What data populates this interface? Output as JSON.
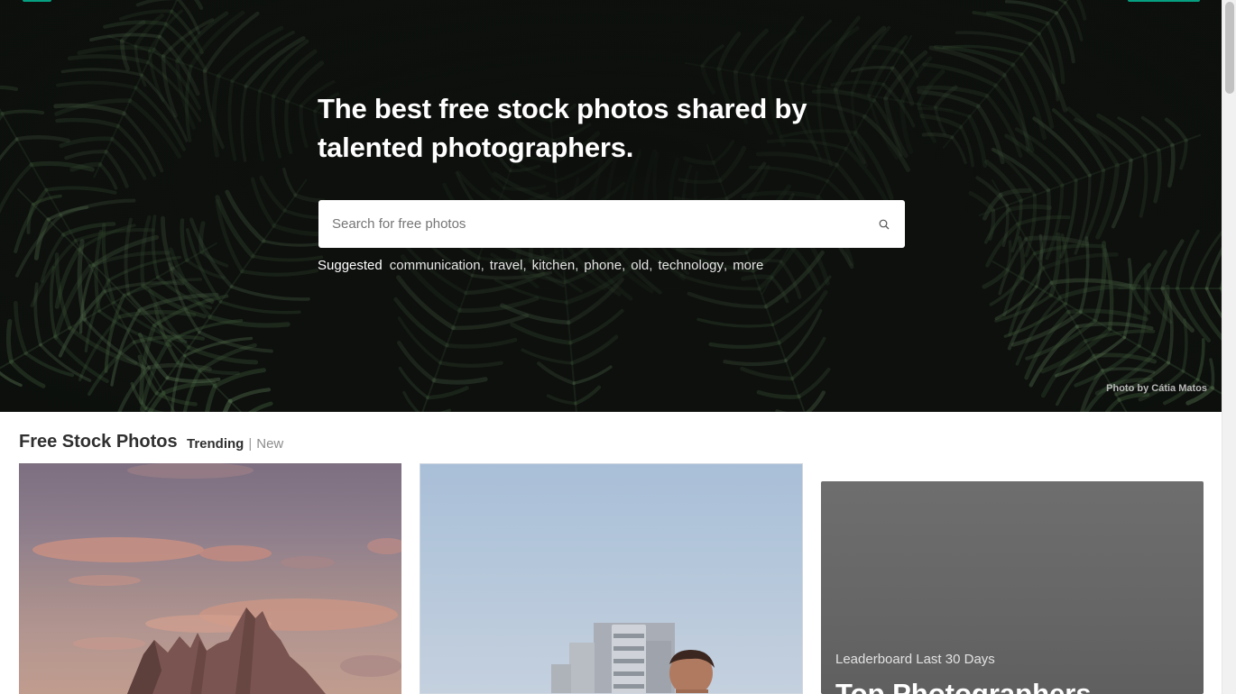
{
  "hero": {
    "title": "The best free stock photos shared by talented photographers.",
    "search_placeholder": "Search for free photos",
    "search_icon": "search-icon",
    "suggested_label": "Suggested",
    "suggestions": [
      "communication",
      "travel",
      "kitchen",
      "phone",
      "old",
      "technology",
      "more"
    ],
    "photo_credit": "Photo by Cátia Matos"
  },
  "section": {
    "title": "Free Stock Photos",
    "tabs": [
      {
        "label": "Trending",
        "active": true
      },
      {
        "label": "New",
        "active": false
      }
    ]
  },
  "leaderboard": {
    "subtitle": "Leaderboard Last 30 Days",
    "title": "Top Photographers"
  },
  "colors": {
    "accent": "#05a081",
    "hero_bg": "#0f120f"
  }
}
